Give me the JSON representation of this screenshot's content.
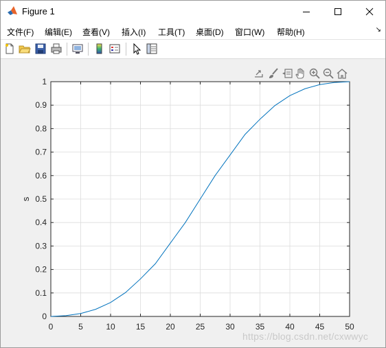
{
  "window": {
    "title": "Figure 1"
  },
  "menu": [
    "文件(F)",
    "编辑(E)",
    "查看(V)",
    "插入(I)",
    "工具(T)",
    "桌面(D)",
    "窗口(W)",
    "帮助(H)"
  ],
  "colors": {
    "line": "#0072bd",
    "grid": "#dcdcdc",
    "axes": "#262626"
  },
  "chart_data": {
    "type": "line",
    "title": "",
    "xlabel": "",
    "ylabel": "s",
    "xlim": [
      0,
      50
    ],
    "ylim": [
      0,
      1
    ],
    "xticks": [
      0,
      5,
      10,
      15,
      20,
      25,
      30,
      35,
      40,
      45,
      50
    ],
    "yticks": [
      0,
      0.1,
      0.2,
      0.3,
      0.4,
      0.5,
      0.6,
      0.7,
      0.8,
      0.9,
      1
    ],
    "grid": true,
    "series": [
      {
        "x": [
          0,
          2.5,
          5,
          7.5,
          10,
          12.5,
          15,
          17.5,
          20,
          22.5,
          25,
          27.5,
          30,
          32.5,
          35,
          37.5,
          40,
          42.5,
          45,
          47.5,
          50
        ],
        "y": [
          0,
          0.0032,
          0.0123,
          0.0303,
          0.0595,
          0.1017,
          0.1599,
          0.2247,
          0.3124,
          0.3997,
          0.5,
          0.6003,
          0.6876,
          0.7753,
          0.8401,
          0.8983,
          0.9405,
          0.9697,
          0.9877,
          0.9968,
          1
        ]
      }
    ]
  },
  "watermark": "https://blog.csdn.net/cxwwyc"
}
